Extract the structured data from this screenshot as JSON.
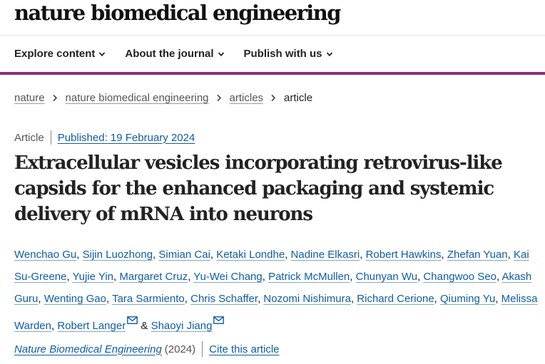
{
  "site": {
    "brand": "nature biomedical engineering"
  },
  "nav": {
    "items": [
      {
        "label": "Explore content"
      },
      {
        "label": "About the journal"
      },
      {
        "label": "Publish with us"
      }
    ]
  },
  "breadcrumb": {
    "items": [
      "nature",
      "nature biomedical engineering",
      "articles"
    ],
    "current": "article"
  },
  "article": {
    "type": "Article",
    "published": "Published: 19 February 2024",
    "title": "Extracellular vesicles incorporating retrovirus-like capsids for the enhanced packaging and systemic delivery of mRNA into neurons",
    "authors": [
      "Wenchao Gu",
      "Sijin Luozhong",
      "Simian Cai",
      "Ketaki Londhe",
      "Nadine Elkasri",
      "Robert Hawkins",
      "Zhefan Yuan",
      "Kai Su-Greene",
      "Yujie Yin",
      "Margaret Cruz",
      "Yu-Wei Chang",
      "Patrick McMullen",
      "Chunyan Wu",
      "Changwoo Seo",
      "Akash Guru",
      "Wenting Gao",
      "Tara Sarmiento",
      "Chris Schaffer",
      "Nozomi Nishimura",
      "Richard Cerione",
      "Qiuming Yu",
      "Melissa Warden",
      "Robert Langer",
      "Shaoyi Jiang"
    ],
    "separator": ", ",
    "ampersand": " & ",
    "journal": "Nature Biomedical Engineering",
    "year": "(2024)",
    "cite_label": "Cite this article"
  },
  "colors": {
    "accent": "#8c2d7b",
    "link": "#0e5ca8",
    "text": "#222222"
  },
  "icons": {
    "nav_dropdown": "chevron-down-icon",
    "breadcrumb_separator": "chevron-right-icon",
    "corresponding_author": "mail-icon"
  }
}
